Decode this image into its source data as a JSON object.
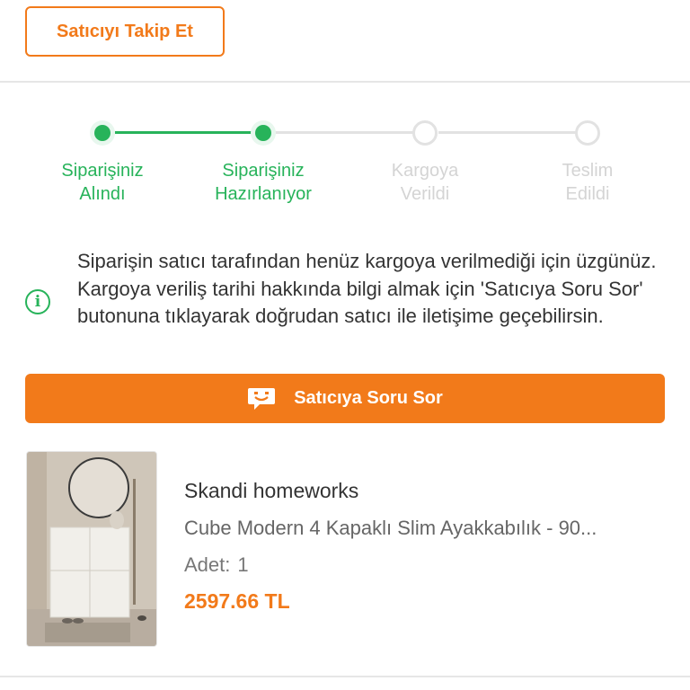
{
  "header": {
    "follow_button_label": "Satıcıyı Takip Et"
  },
  "order_status": {
    "steps": [
      {
        "label_line1": "Siparişiniz",
        "label_line2": "Alındı",
        "state": "done"
      },
      {
        "label_line1": "Siparişiniz",
        "label_line2": "Hazırlanıyor",
        "state": "done"
      },
      {
        "label_line1": "Kargoya",
        "label_line2": "Verildi",
        "state": "todo"
      },
      {
        "label_line1": "Teslim",
        "label_line2": "Edildi",
        "state": "todo"
      }
    ],
    "colors": {
      "done": "#27b35a",
      "todo": "#e2e2e2"
    }
  },
  "info": {
    "icon": "info-icon",
    "message": "Siparişin satıcı tarafından henüz kargoya verilmediği için üzgünüz. Kargoya veriliş tarihi hakkında bilgi almak için 'Satıcıya Soru Sor' butonuna tıklayarak doğrudan satıcı ile iletişime geçebilirsin."
  },
  "ask_button": {
    "label": "Satıcıya Soru Sor",
    "icon": "chat-bubble-icon"
  },
  "product": {
    "seller": "Skandi homeworks",
    "title": "Cube Modern 4 Kapaklı Slim Ayakkabılık - 90...",
    "quantity_label": "Adet:",
    "quantity_value": "1",
    "price": "2597.66 TL"
  },
  "theme": {
    "accent": "#f27a1a",
    "success": "#27b35a"
  }
}
